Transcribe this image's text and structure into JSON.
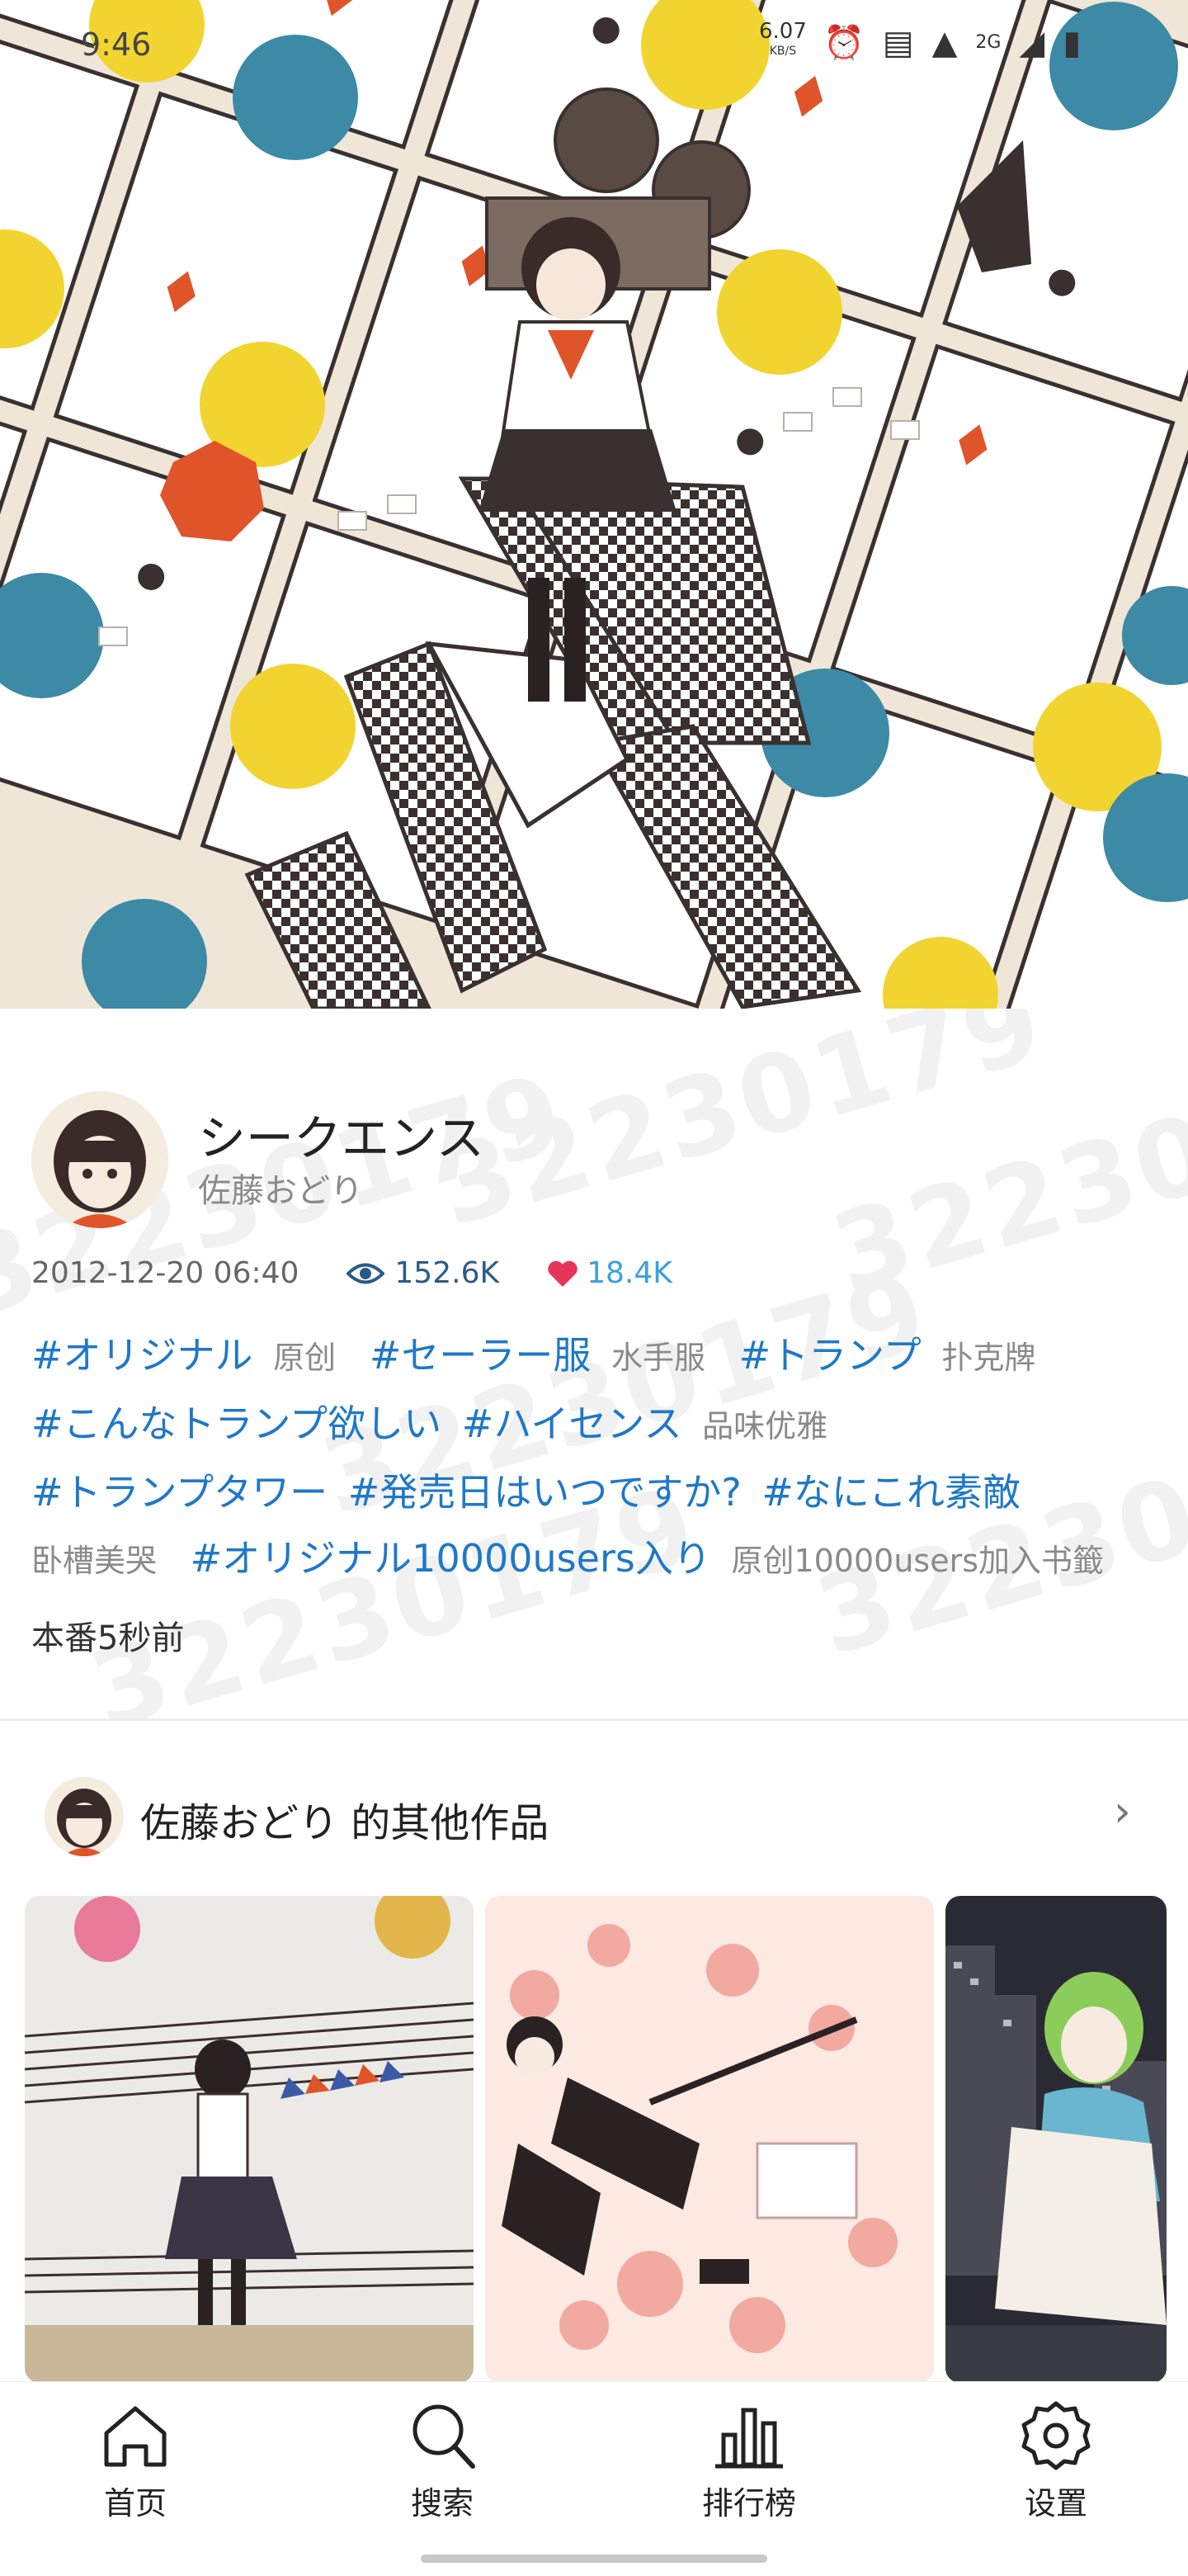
{
  "status_bar": {
    "time": "9:46",
    "net_speed": "6.07",
    "net_unit": "KB/S",
    "network": "2G",
    "icons": [
      "alarm-icon",
      "vibrate-icon",
      "wifi-icon",
      "signal-icon",
      "battery-icon"
    ]
  },
  "artwork": {
    "title": "シークエンス",
    "author": "佐藤おどり",
    "date": "2012-12-20 06:40",
    "views": "152.6K",
    "likes": "18.4K",
    "tags": [
      {
        "tag": "#オリジナル",
        "translation": "原创"
      },
      {
        "tag": "#セーラー服",
        "translation": "水手服"
      },
      {
        "tag": "#トランプ",
        "translation": "扑克牌"
      },
      {
        "tag": "#こんなトランプ欲しい",
        "translation": ""
      },
      {
        "tag": "#ハイセンス",
        "translation": "品味优雅"
      },
      {
        "tag": "#トランプタワー",
        "translation": ""
      },
      {
        "tag": "#発売日はいつですか?",
        "translation": ""
      },
      {
        "tag": "#なにこれ素敵",
        "translation": "卧槽美哭"
      },
      {
        "tag": "#オリジナル10000users入り",
        "translation": "原创10000users加入书籤"
      }
    ],
    "caption": "本番5秒前",
    "watermark": "32230179"
  },
  "other_works": {
    "author": "佐藤おどり",
    "title": "佐藤おどり 的其他作品"
  },
  "bottom_nav": {
    "items": [
      {
        "label": "首页",
        "icon": "home-icon"
      },
      {
        "label": "搜索",
        "icon": "search-icon"
      },
      {
        "label": "排行榜",
        "icon": "ranking-icon"
      },
      {
        "label": "设置",
        "icon": "gear-icon"
      }
    ]
  },
  "colors": {
    "tag": "#1f78c8",
    "likes": "#3aa0e0",
    "heart": "#e8335a",
    "views": "#2a5a88"
  }
}
